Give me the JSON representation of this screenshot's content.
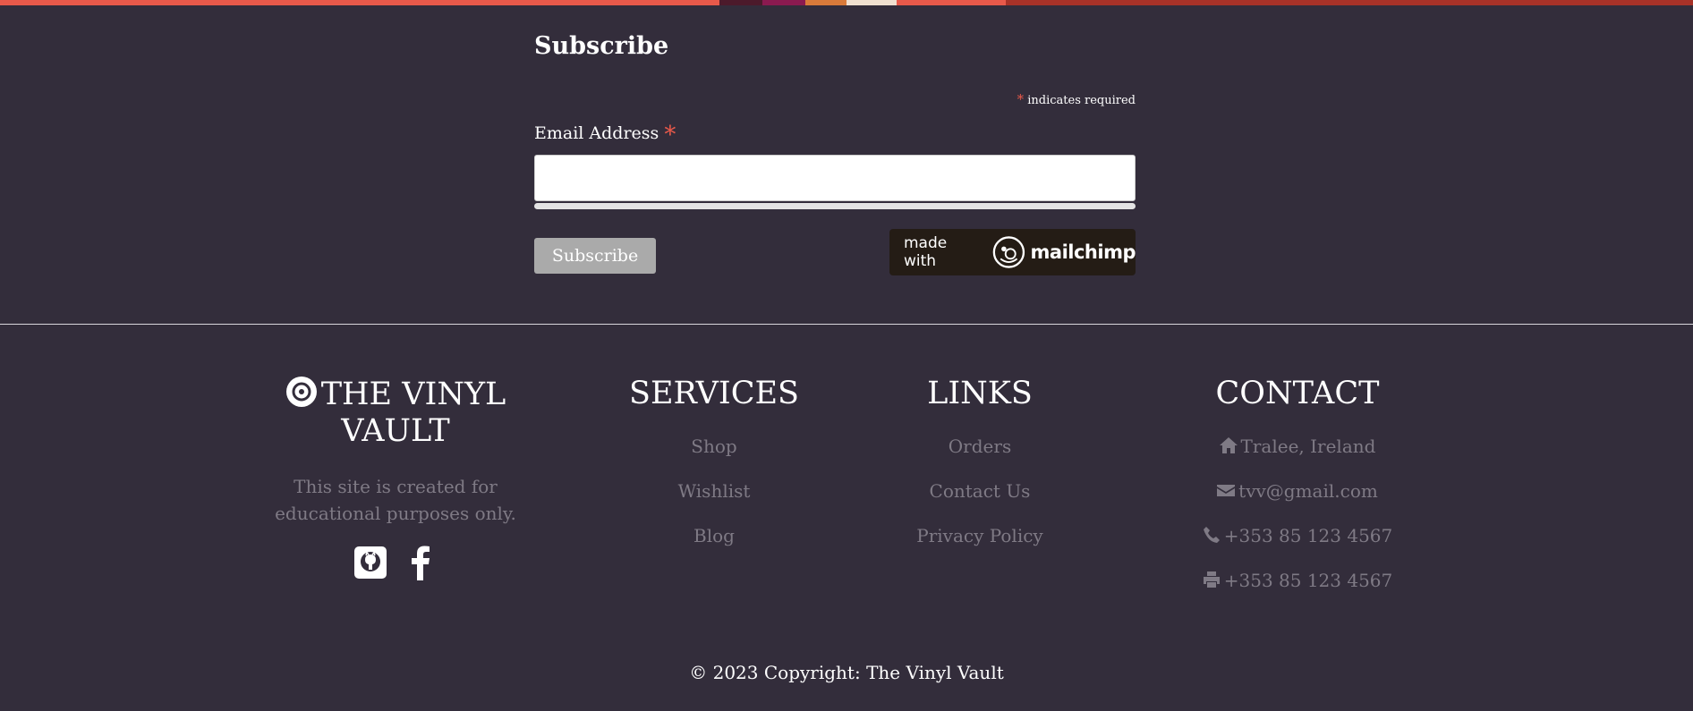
{
  "topbar": {
    "colors": [
      "#e8594a",
      "#4c1a2b",
      "#8b1a50",
      "#d97a3a",
      "#f0e0d0",
      "#e8594a",
      "#a83228"
    ]
  },
  "subscribe": {
    "title": "Subscribe",
    "required_star": "*",
    "required_note": "indicates required",
    "email_label": "Email Address",
    "email_value": "",
    "email_placeholder": "",
    "button_label": "Subscribe",
    "badge_made_with": "made with",
    "badge_brand": "mailchimp"
  },
  "footer": {
    "brand": {
      "icon": "vinyl-record-icon",
      "title": "THE VINYL VAULT",
      "description": "This site is created for educational purposes only.",
      "social": [
        "github-icon",
        "facebook-icon"
      ]
    },
    "services": {
      "title": "SERVICES",
      "items": [
        "Shop",
        "Wishlist",
        "Blog"
      ]
    },
    "links": {
      "title": "LINKS",
      "items": [
        "Orders",
        "Contact Us",
        "Privacy Policy"
      ]
    },
    "contact": {
      "title": "CONTACT",
      "items": [
        {
          "icon": "home-icon",
          "text": "Tralee, Ireland"
        },
        {
          "icon": "envelope-icon",
          "text": "tvv@gmail.com"
        },
        {
          "icon": "phone-icon",
          "text": "+353 85 123 4567"
        },
        {
          "icon": "printer-icon",
          "text": "+353 85 123 4567"
        }
      ]
    },
    "copyright": "© 2023 Copyright: The Vinyl Vault"
  },
  "colors": {
    "background": "#332d3b",
    "muted_text": "#7f7a85",
    "required_red": "#e8594a",
    "button_gray": "#aaaaaa",
    "badge_dark": "#241c15"
  }
}
